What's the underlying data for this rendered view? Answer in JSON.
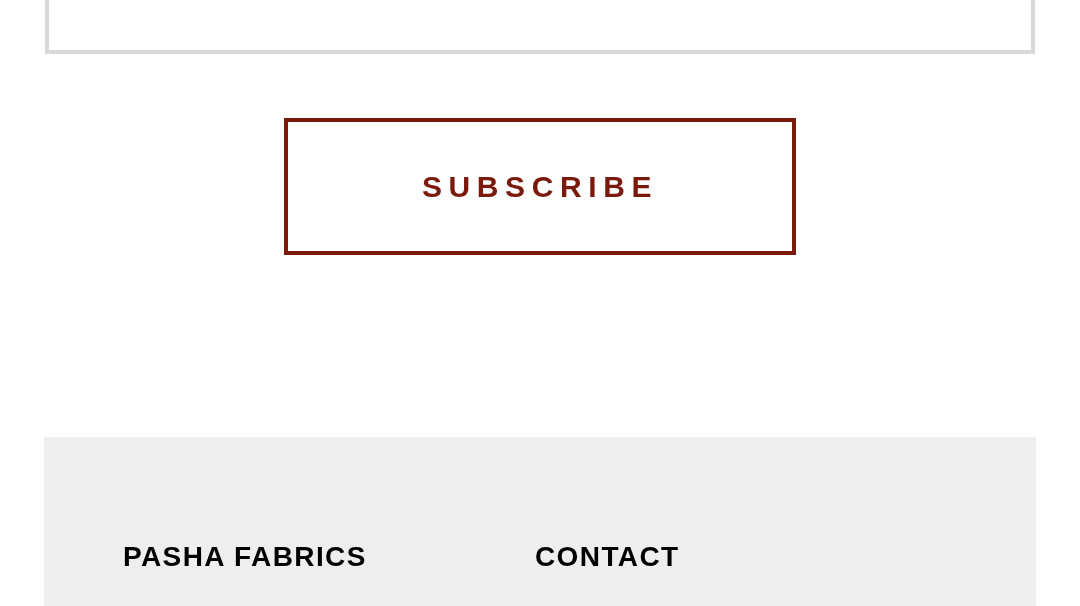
{
  "subscribe_form": {
    "button": "SUBSCRIBE"
  },
  "footer": {
    "columns": [
      {
        "heading": "PASHA FABRICS"
      },
      {
        "heading": "CONTACT"
      }
    ]
  }
}
